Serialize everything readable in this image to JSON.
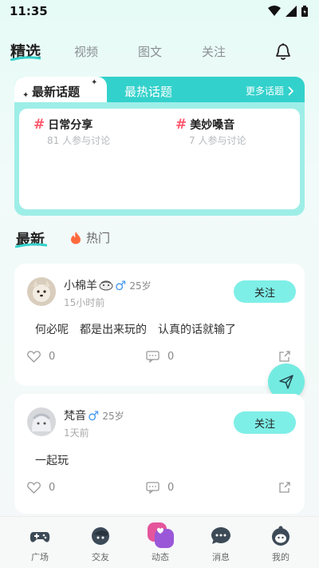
{
  "status_bar": {
    "time": "11:35"
  },
  "top_tabs": [
    {
      "label": "精选",
      "active": true
    },
    {
      "label": "视频",
      "active": false
    },
    {
      "label": "图文",
      "active": false
    },
    {
      "label": "关注",
      "active": false
    }
  ],
  "topic_card": {
    "tab_latest": "最新话题",
    "tab_hot": "最热话题",
    "more": "更多话题",
    "items": [
      {
        "name": "日常分享",
        "count": "81 人参与讨论"
      },
      {
        "name": "美妙嗓音",
        "count": "7 人参与讨论"
      }
    ]
  },
  "section_tabs": {
    "latest": "最新",
    "hot": "热门"
  },
  "posts": [
    {
      "username": "小棉羊",
      "gender": "♂",
      "age": "25岁",
      "time": "15小时前",
      "follow": "关注",
      "text": "何必呢　都是出来玩的　认真的话就输了",
      "likes": "0",
      "comments": "0"
    },
    {
      "username": "梵音",
      "gender": "♂",
      "age": "25岁",
      "time": "1天前",
      "follow": "关注",
      "text": "一起玩",
      "likes": "0",
      "comments": "0"
    }
  ],
  "bottom_nav": [
    {
      "label": "广场",
      "icon": "gamepad-icon"
    },
    {
      "label": "交友",
      "icon": "friend-icon"
    },
    {
      "label": "动态",
      "icon": "moments-icon",
      "active": true
    },
    {
      "label": "消息",
      "icon": "message-icon"
    },
    {
      "label": "我的",
      "icon": "profile-icon"
    }
  ],
  "colors": {
    "accent": "#33d1cb",
    "follow_bg": "#7eefe7",
    "hash": "#ff5a6e",
    "fire": "#ff6a3d"
  }
}
